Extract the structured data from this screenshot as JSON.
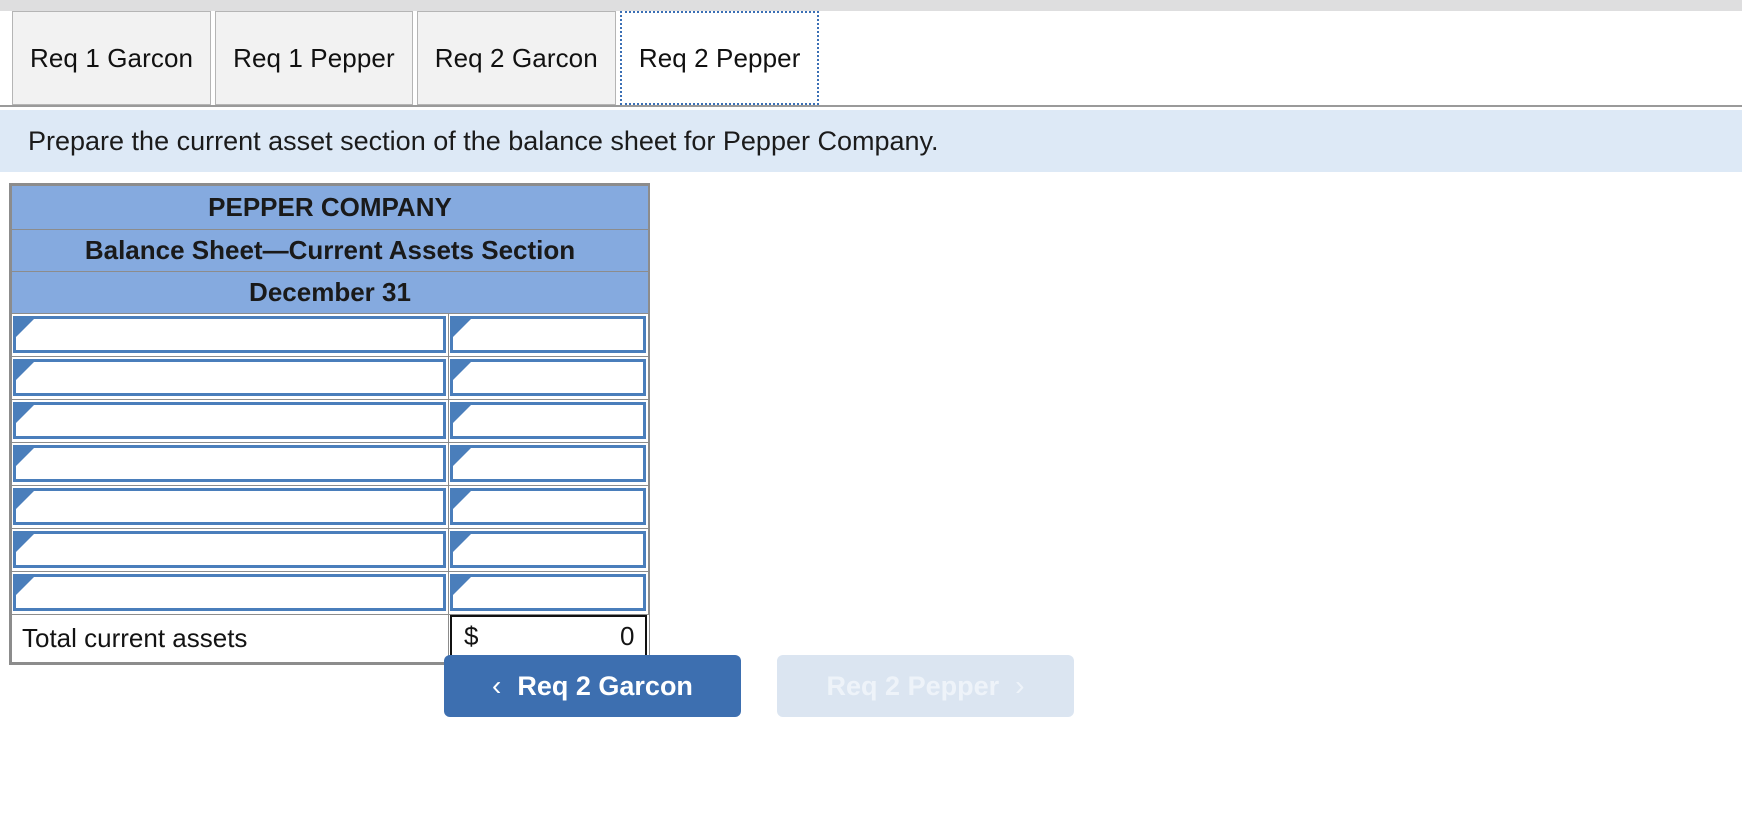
{
  "window": {
    "top_strip_color": "#dededf",
    "background": "#ffffff"
  },
  "tabs": {
    "items": [
      {
        "label": "Req 1 Garcon",
        "active": false
      },
      {
        "label": "Req 1 Pepper",
        "active": false
      },
      {
        "label": "Req 2 Garcon",
        "active": false
      },
      {
        "label": "Req 2 Pepper",
        "active": true
      }
    ]
  },
  "instruction": {
    "text": "Prepare the current asset section of the balance sheet for Pepper Company.",
    "background": "#dde9f6"
  },
  "sheet": {
    "header_background": "#85aadf",
    "input_border_color": "#4a7ebb",
    "headers": [
      "PEPPER COMPANY",
      "Balance Sheet—Current Assets Section",
      "December 31"
    ],
    "input_rows": [
      {
        "label_value": "",
        "amount_value": ""
      },
      {
        "label_value": "",
        "amount_value": ""
      },
      {
        "label_value": "",
        "amount_value": ""
      },
      {
        "label_value": "",
        "amount_value": ""
      },
      {
        "label_value": "",
        "amount_value": ""
      },
      {
        "label_value": "",
        "amount_value": ""
      },
      {
        "label_value": "",
        "amount_value": ""
      }
    ],
    "total": {
      "label": "Total current assets",
      "currency": "$",
      "amount": "0"
    }
  },
  "navigation": {
    "prev": {
      "label": "Req 2 Garcon",
      "chevron": "‹",
      "enabled": true,
      "color": "#3d6fb0"
    },
    "next": {
      "label": "Req 2 Pepper",
      "chevron": "›",
      "enabled": false,
      "color": "#dbe5f1"
    }
  }
}
